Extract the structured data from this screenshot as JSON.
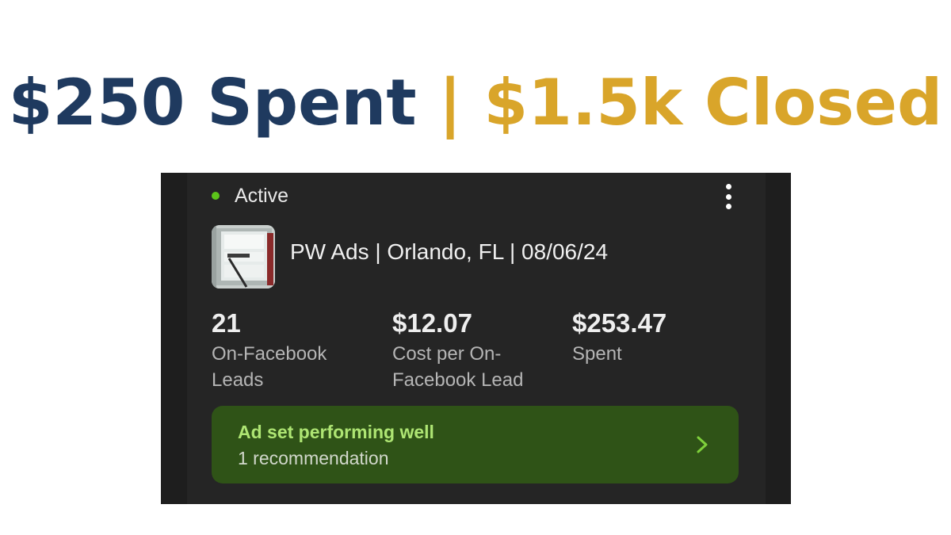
{
  "headline": {
    "spent": "$250 Spent ",
    "closed": "| $1.5k Closed",
    "spent_color": "#1f3a5f",
    "closed_color": "#d9a52a"
  },
  "ad_card": {
    "status": "Active",
    "status_color": "#5cc41a",
    "menu_icon": "more-vertical-icon",
    "thumbnail_icon": "ad-thumbnail-image",
    "title": "PW Ads | Orlando, FL | 08/06/24",
    "metrics": [
      {
        "value": "21",
        "label_line1": "On-Facebook",
        "label_line2": "Leads"
      },
      {
        "value": "$12.07",
        "label_line1": "Cost per On-",
        "label_line2": "Facebook Lead"
      },
      {
        "value": "$253.47",
        "label_line1": "Spent",
        "label_line2": ""
      }
    ],
    "recommendation": {
      "title": "Ad set performing well",
      "subtitle": "1 recommendation",
      "icon": "chevron-right-icon",
      "accent": "#aee573"
    }
  }
}
